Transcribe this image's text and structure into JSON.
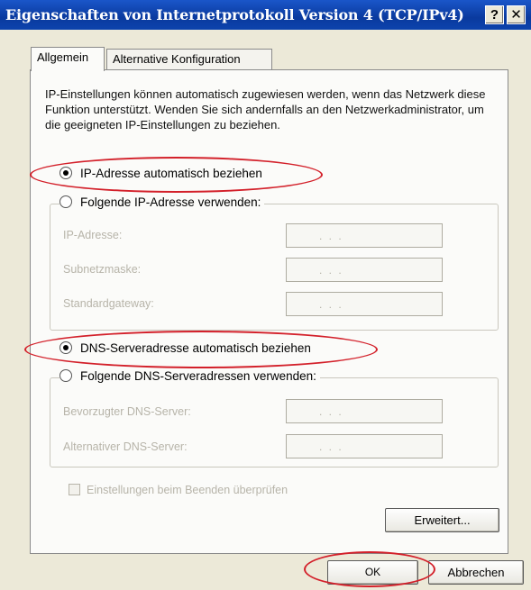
{
  "window": {
    "title": "Eigenschaften von Internetprotokoll Version 4 (TCP/IPv4)",
    "help_label": "?",
    "close_label": "✕"
  },
  "tabs": [
    {
      "label": "Allgemein",
      "active": true
    },
    {
      "label": "Alternative Konfiguration",
      "active": false
    }
  ],
  "general": {
    "description": "IP-Einstellungen können automatisch zugewiesen werden, wenn das Netzwerk diese Funktion unterstützt. Wenden Sie sich andernfalls an den Netzwerkadministrator, um die geeigneten IP-Einstellungen zu beziehen.",
    "ip_auto_label": "IP-Adresse automatisch beziehen",
    "ip_manual_label": "Folgende IP-Adresse verwenden:",
    "ip_address_label": "IP-Adresse:",
    "subnet_label": "Subnetzmaske:",
    "gateway_label": "Standardgateway:",
    "dns_auto_label": "DNS-Serveradresse automatisch beziehen",
    "dns_manual_label": "Folgende DNS-Serveradressen verwenden:",
    "dns_preferred_label": "Bevorzugter DNS-Server:",
    "dns_alternate_label": "Alternativer DNS-Server:",
    "validate_label": "Einstellungen beim Beenden überprüfen",
    "advanced_label": "Erweitert..."
  },
  "ip_placeholder_dots": ".   .   .",
  "footer": {
    "ok_label": "OK",
    "cancel_label": "Abbrechen"
  },
  "selection": {
    "ip_mode": "automatic",
    "dns_mode": "automatic",
    "validate_checked": false
  },
  "annotation_color": "#d3202a"
}
